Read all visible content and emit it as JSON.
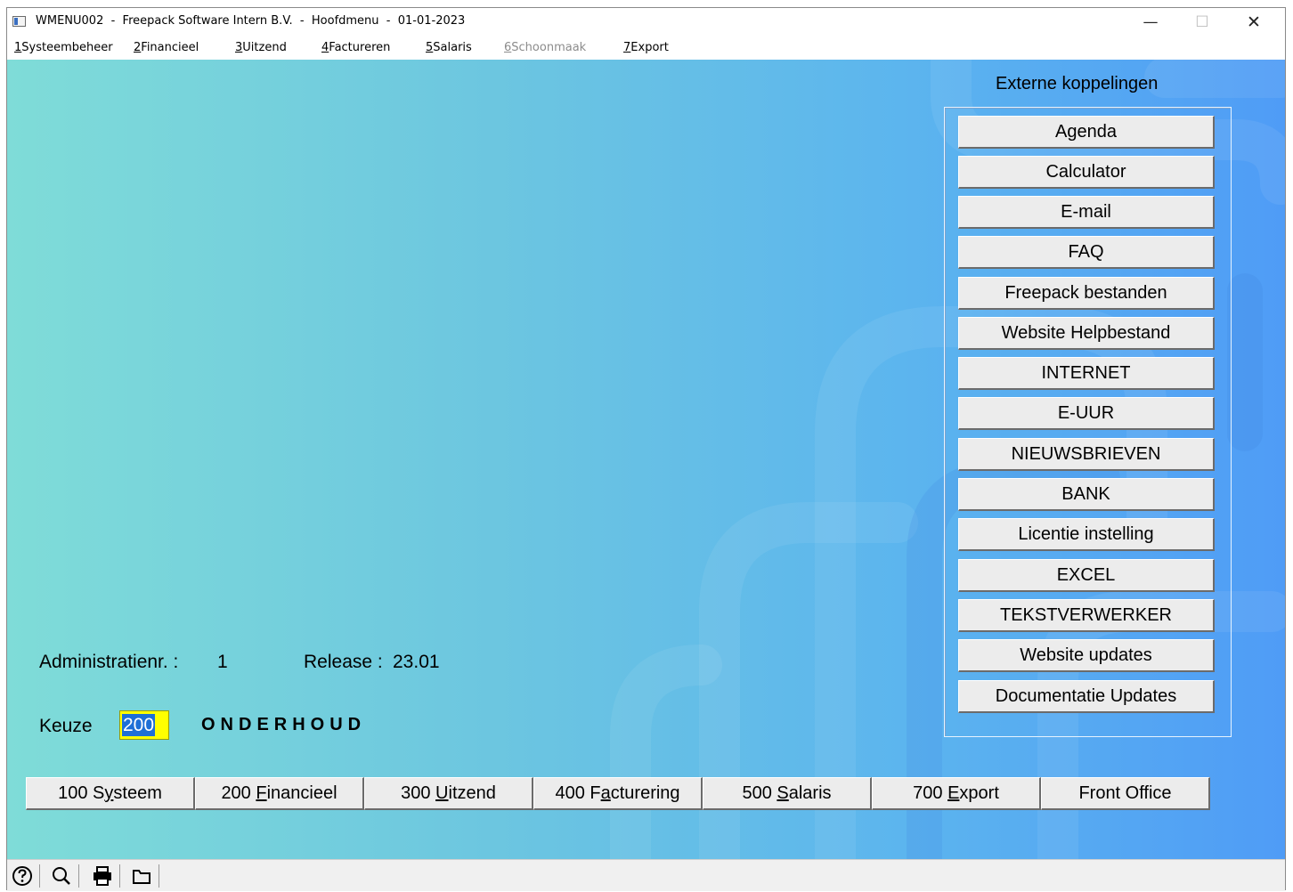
{
  "window": {
    "title": "WMENU002  -  Freepack Software Intern B.V.  -  Hoofdmenu  -  01-01-2023",
    "minimize_glyph": "—",
    "maximize_glyph": "☐",
    "close_glyph": "✕"
  },
  "menu": [
    {
      "key": "1",
      "label": "Systeembeheer"
    },
    {
      "key": "2",
      "label": "Financieel"
    },
    {
      "key": "3",
      "label": "Uitzend"
    },
    {
      "key": "4",
      "label": "Factureren"
    },
    {
      "key": "5",
      "label": "Salaris"
    },
    {
      "key": "6",
      "label": "Schoonmaak",
      "disabled": true
    },
    {
      "key": "7",
      "label": "Export"
    }
  ],
  "external": {
    "title": "Externe koppelingen",
    "buttons": [
      "Agenda",
      "Calculator",
      "E-mail",
      "FAQ",
      "Freepack bestanden",
      "Website Helpbestand",
      "INTERNET",
      "E-UUR",
      "NIEUWSBRIEVEN",
      "BANK",
      "Licentie instelling",
      "EXCEL",
      "TEKSTVERWERKER",
      "Website updates",
      "Documentatie Updates"
    ]
  },
  "info": {
    "admin_label": "Administratienr. :",
    "admin_value": "1",
    "release_label": "Release :",
    "release_value": "23.01"
  },
  "keuze": {
    "label": "Keuze",
    "value": "200",
    "description": "ONDERHOUD"
  },
  "nav_buttons": [
    {
      "pre": "100 S",
      "u": "y",
      "post": "steem"
    },
    {
      "pre": "200 ",
      "u": "F",
      "post": "inancieel"
    },
    {
      "pre": "300 ",
      "u": "U",
      "post": "itzend"
    },
    {
      "pre": "400 F",
      "u": "a",
      "post": "cturering"
    },
    {
      "pre": "500 ",
      "u": "S",
      "post": "alaris"
    },
    {
      "pre": "700 ",
      "u": "E",
      "post": "xport"
    },
    {
      "pre": "Front Office",
      "u": "",
      "post": ""
    }
  ],
  "statusbar_icons": [
    "help-icon",
    "search-icon",
    "print-icon",
    "folder-icon"
  ],
  "colors": {
    "gradient_left": "#7fdcd8",
    "gradient_right": "#4f9cf6",
    "keuze_bg": "#ffff00",
    "selection": "#1e6fd6"
  }
}
